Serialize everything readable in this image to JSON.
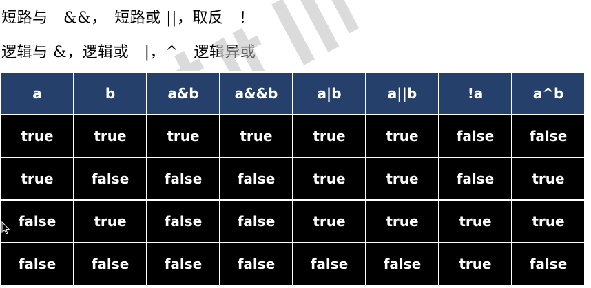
{
  "text": {
    "line1": "短路与　&&，　短路或 ||，取反　！",
    "line2": "逻辑与 &，逻辑或　|，^　逻辑异或"
  },
  "table": {
    "headers": [
      "a",
      "b",
      "a&b",
      "a&&b",
      "a|b",
      "a||b",
      "!a",
      "a^b"
    ],
    "rows": [
      [
        "true",
        "true",
        "true",
        "true",
        "true",
        "true",
        "false",
        "false"
      ],
      [
        "true",
        "false",
        "false",
        "false",
        "true",
        "true",
        "false",
        "true"
      ],
      [
        "false",
        "true",
        "false",
        "false",
        "true",
        "true",
        "true",
        "true"
      ],
      [
        "false",
        "false",
        "false",
        "false",
        "false",
        "false",
        "true",
        "false"
      ]
    ]
  },
  "colors": {
    "header_bg": "#24406b",
    "cell_bg": "#000000",
    "text": "#ffffff"
  }
}
